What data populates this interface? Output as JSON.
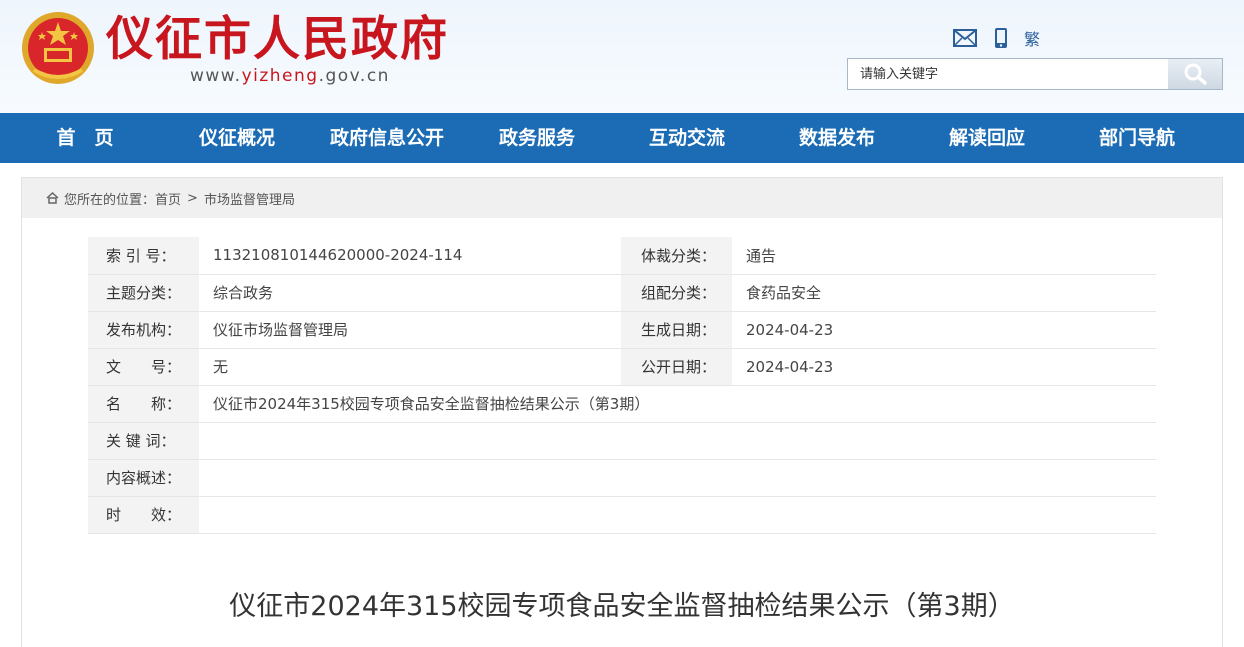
{
  "header": {
    "site_title": "仪征市人民政府",
    "url_prefix": "www.",
    "url_accent": "yizheng",
    "url_suffix": ".gov.cn",
    "tools": {
      "mail_icon": "mail-icon",
      "mobile_icon": "mobile-icon",
      "traditional_label": "繁"
    },
    "search": {
      "placeholder": "请输入关键字",
      "icon": "search-icon"
    }
  },
  "nav": {
    "items": [
      {
        "label": "首　页"
      },
      {
        "label": "仪征概况"
      },
      {
        "label": "政府信息公开"
      },
      {
        "label": "政务服务"
      },
      {
        "label": "互动交流"
      },
      {
        "label": "数据发布"
      },
      {
        "label": "解读回应"
      },
      {
        "label": "部门导航"
      }
    ]
  },
  "breadcrumb": {
    "prefix": "您所在的位置：",
    "home": "首页",
    "separator": ">",
    "current": "市场监督管理局"
  },
  "info": {
    "index_label": "索 引 号：",
    "index_value": "113210810144620000-2024-114",
    "genre_label": "体裁分类：",
    "genre_value": "通告",
    "topic_label": "主题分类：",
    "topic_value": "综合政务",
    "org_cat_label": "组配分类：",
    "org_cat_value": "食药品安全",
    "publisher_label": "发布机构：",
    "publisher_value": "仪征市场监督管理局",
    "created_label": "生成日期：",
    "created_value": "2024-04-23",
    "docno_label": "文　　号：",
    "docno_value": "无",
    "published_label": "公开日期：",
    "published_value": "2024-04-23",
    "name_label": "名　　称：",
    "name_value": "仪征市2024年315校园专项食品安全监督抽检结果公示（第3期）",
    "keywords_label": "关 键 词：",
    "keywords_value": "",
    "summary_label": "内容概述：",
    "summary_value": "",
    "validity_label": "时　　效：",
    "validity_value": ""
  },
  "article": {
    "title": "仪征市2024年315校园专项食品安全监督抽检结果公示（第3期）"
  },
  "colors": {
    "brand_red": "#c8161e",
    "nav_blue": "#1b6cb5"
  }
}
